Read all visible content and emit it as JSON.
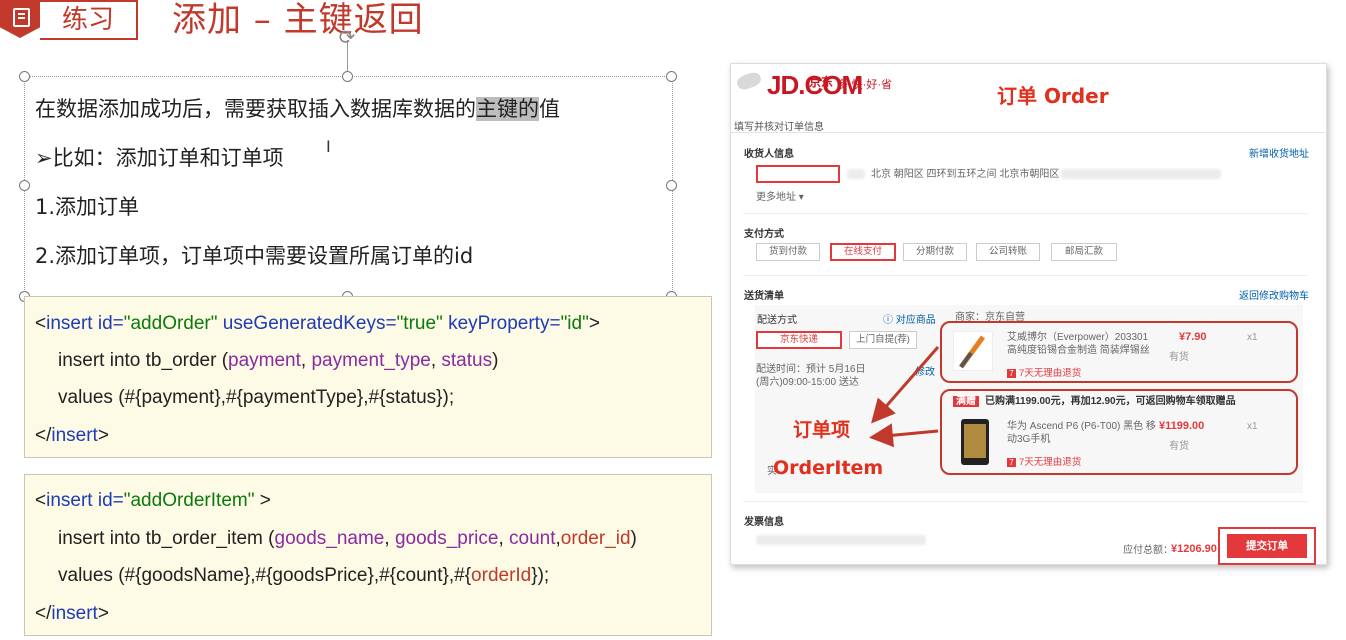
{
  "header": {
    "tag_label": "练习",
    "title": "添加 – 主键返回",
    "rotate_glyph": "⟳"
  },
  "bullets": {
    "line1_pre": "在数据添加成功后，需要获取插入数据库数据的",
    "line1_hl": "主键的",
    "line1_post": "值",
    "line2": "➢比如：添加订单和订单项",
    "line3": "1.添加订单",
    "line4": "2.添加订单项，订单项中需要设置所属订单的id",
    "cursor": "I"
  },
  "code1": {
    "l1_open": "<",
    "l1_tag": "insert",
    "l1_sp": " ",
    "l1_attr_id": "id=",
    "l1_val_id": "\"addOrder\"",
    "l1_attr_ugk": "useGeneratedKeys=",
    "l1_val_ugk": "\"true\"",
    "l1_attr_kp": "keyProperty=",
    "l1_val_kp": "\"id\"",
    "l1_close": ">",
    "l2_pre": "insert into tb_order (",
    "l2_c1": "payment",
    "l2_s1": ", ",
    "l2_c2": "payment_type",
    "l2_s2": ", ",
    "l2_c3": "status",
    "l2_end": ")",
    "l3": "values (#{payment},#{paymentType},#{status});",
    "l4_open": "</",
    "l4_tag": "insert",
    "l4_close": ">"
  },
  "code2": {
    "l1_open": "<",
    "l1_tag": "insert",
    "l1_attr_id": "id=",
    "l1_val_id": "\"addOrderItem\"",
    "l1_close": " >",
    "l2_pre": "insert into tb_order_item (",
    "l2_c1": "goods_name",
    "l2_s1": ", ",
    "l2_c2": "goods_price",
    "l2_s2": ", ",
    "l2_c3": "count",
    "l2_s3": ",",
    "l2_c4": "order_id",
    "l2_end": ")",
    "l3_pre": "values (#{goodsName},#{goodsPrice},#{count},#{",
    "l3_hv": "orderId",
    "l3_end": "});",
    "l4_open": "</",
    "l4_tag": "insert",
    "l4_close": ">"
  },
  "jd": {
    "logo": "JD.COM",
    "logo_cn": "京东",
    "slogan": "多·快·好·省",
    "order_anno": "订单 Order",
    "page_title": "填写并核对订单信息",
    "receiver": {
      "heading": "收货人信息",
      "add_link": "新增收货地址",
      "address": "北京 朝阳区 四环到五环之间 北京市朝阳区",
      "more": "更多地址 ▾"
    },
    "payment": {
      "heading": "支付方式",
      "options": [
        "货到付款",
        "在线支付",
        "分期付款",
        "公司转账",
        "邮局汇款"
      ]
    },
    "shipping": {
      "heading": "送货清单",
      "back_link": "返回修改购物车",
      "method_label": "配送方式",
      "goods_link": "ⓘ 对应商品",
      "seller": "商家：京东自营",
      "methods": [
        "京东快递",
        "上门自提(荐)"
      ],
      "time_label": "配送时间：预计 5月16日(周六)09:00-15:00 送达",
      "edit": "修改",
      "items": [
        {
          "name": "艾威博尔（Everpower）203301 高纯度铅锡合金制造 简装焊锡丝",
          "price": "¥7.90",
          "qty": "x1",
          "stock": "有货",
          "return": "7天无理由退货"
        },
        {
          "name": "华为 Ascend P6 (P6-T00) 黑色 移动3G手机",
          "price": "¥1199.00",
          "qty": "x1",
          "stock": "有货",
          "return": "7天无理由退货"
        }
      ],
      "promo_tag": "满赠",
      "promo_text": "已购满1199.00元，再加12.90元，可返回购物车领取赠品",
      "item_anno_cn": "订单项",
      "item_anno_en": "OrderItem",
      "bottom_text": "实"
    },
    "invoice": {
      "heading": "发票信息",
      "total_label": "应付总额：",
      "total_value": "¥1206.90",
      "submit": "提交订单"
    }
  }
}
